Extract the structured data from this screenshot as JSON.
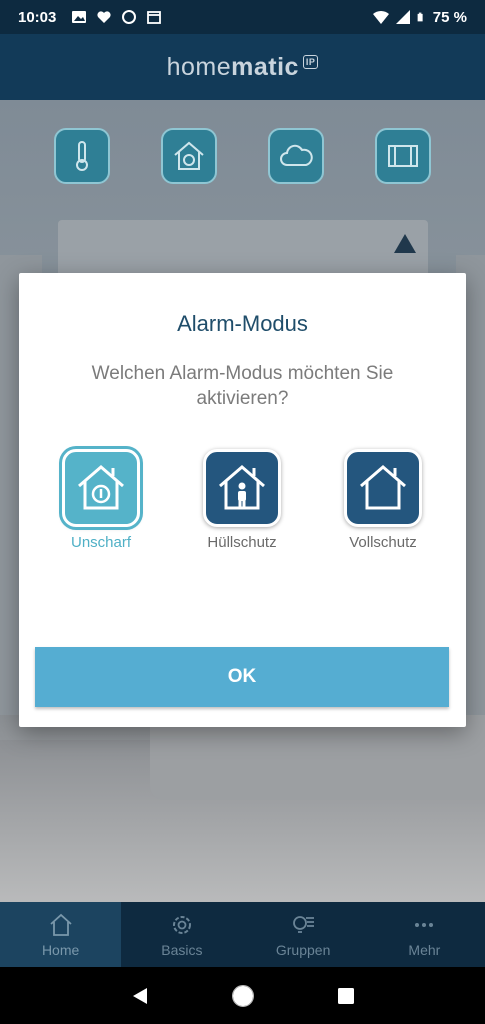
{
  "status_bar": {
    "time": "10:03",
    "battery_percent": "75 %",
    "left_icons": [
      "image-icon",
      "heart-icon",
      "circle-icon",
      "calendar-icon"
    ],
    "right_icons": [
      "wifi-icon",
      "signal-icon",
      "battery-icon"
    ]
  },
  "header": {
    "logo_light": "home",
    "logo_bold": "matic",
    "logo_badge": "IP"
  },
  "quick_actions": [
    "thermometer-icon",
    "alarm-house-icon",
    "cloud-icon",
    "window-icon"
  ],
  "dialog": {
    "title": "Alarm-Modus",
    "question": "Welchen Alarm-Modus möchten Sie aktivieren?",
    "modes": [
      {
        "label": "Unscharf",
        "icon": "house-disarmed-icon",
        "selected": true
      },
      {
        "label": "Hüllschutz",
        "icon": "house-person-icon",
        "selected": false
      },
      {
        "label": "Vollschutz",
        "icon": "house-icon",
        "selected": false
      }
    ],
    "ok_label": "OK"
  },
  "tabs": [
    {
      "label": "Home",
      "icon": "home-icon",
      "active": true
    },
    {
      "label": "Basics",
      "icon": "gear-icon",
      "active": false
    },
    {
      "label": "Gruppen",
      "icon": "group-icon",
      "active": false
    },
    {
      "label": "Mehr",
      "icon": "more-icon",
      "active": false
    }
  ],
  "colors": {
    "header_bg": "#123a58",
    "title_color": "#1f4d6a",
    "selected_mode": "#55b3c9",
    "mode_tile": "#24567e",
    "ok_button": "#55add2"
  }
}
